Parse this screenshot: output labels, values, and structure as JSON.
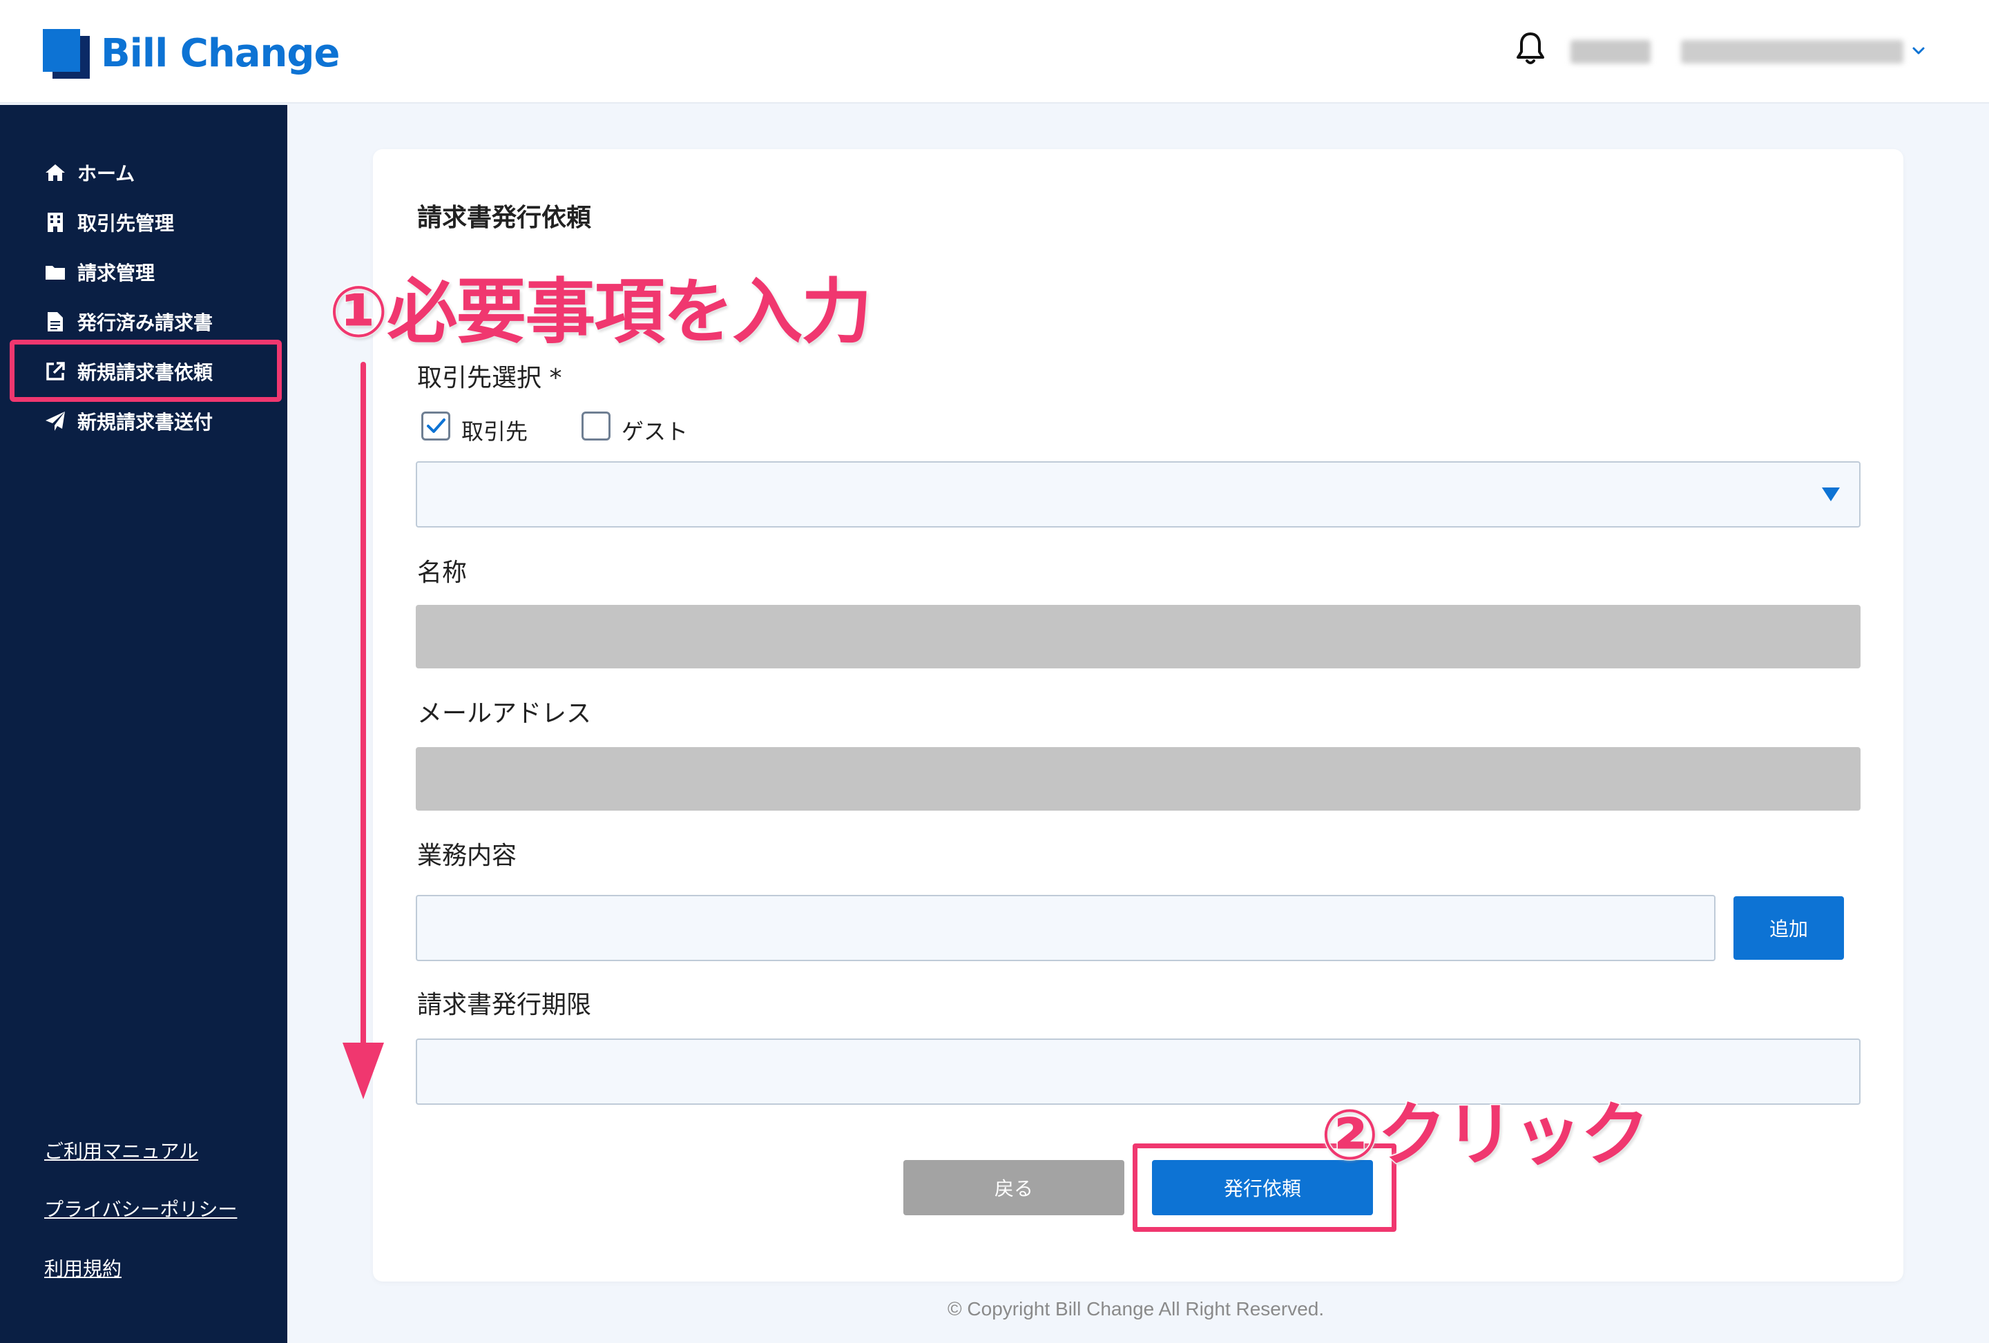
{
  "app": {
    "brand": "Bill Change"
  },
  "sidebar": {
    "items": [
      {
        "label": "ホーム",
        "icon": "home-icon"
      },
      {
        "label": "取引先管理",
        "icon": "building-icon"
      },
      {
        "label": "請求管理",
        "icon": "folder-icon"
      },
      {
        "label": "発行済み請求書",
        "icon": "document-icon"
      },
      {
        "label": "新規請求書依頼",
        "icon": "external-link-icon"
      },
      {
        "label": "新規請求書送付",
        "icon": "paper-plane-icon"
      }
    ],
    "active_item": "新規請求書依頼",
    "links": [
      {
        "label": "ご利用マニュアル"
      },
      {
        "label": "プライバシーポリシー"
      },
      {
        "label": "利用規約"
      }
    ]
  },
  "form": {
    "title": "請求書発行依頼",
    "partner_select": {
      "label": "取引先選択 *",
      "options": [
        {
          "label": "取引先",
          "checked": true
        },
        {
          "label": "ゲスト",
          "checked": false
        }
      ],
      "value": ""
    },
    "name": {
      "label": "名称",
      "value": ""
    },
    "email": {
      "label": "メールアドレス",
      "value": ""
    },
    "work": {
      "label": "業務内容",
      "value": "",
      "add_label": "追加"
    },
    "deadline": {
      "label": "請求書発行期限",
      "value": ""
    },
    "back_label": "戻る",
    "submit_label": "発行依頼"
  },
  "annotations": {
    "step1": "①必要事項を入力",
    "step2": "②クリック",
    "highlight_color": "#f0376f"
  },
  "footer": {
    "copyright": "© Copyright Bill Change All Right Reserved."
  },
  "colors": {
    "primary": "#0d73d4",
    "sidebar_bg": "#0a1f44",
    "page_bg": "#f2f6fc"
  }
}
